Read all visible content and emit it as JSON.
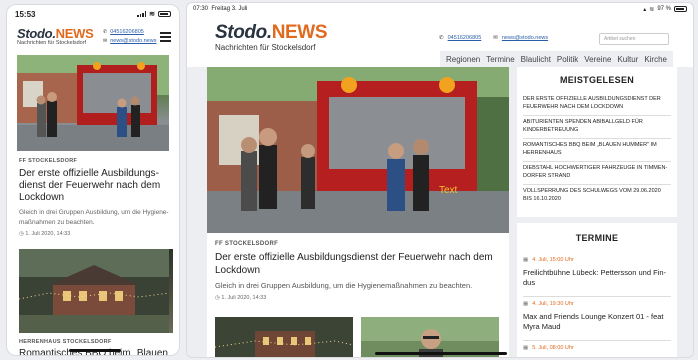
{
  "phone": {
    "status": {
      "time": "15:53"
    },
    "header": {
      "logo_main": "Stodo.",
      "logo_news": "NEWS",
      "logo_sub": "Nachrichten für Stockelsdorf",
      "phone": "04516206805",
      "email": "news@stodo.news"
    },
    "article1": {
      "category": "FF STOCKELSDORF",
      "title": "Der erste offizielle Ausbildungs­dienst der Feuerwehr nach dem Lockdown",
      "teaser": "Gleich in drei Gruppen Ausbildung, um die Hygiene­maßnahmen zu beachten.",
      "date": "1. Juli 2020, 14:33"
    },
    "article2": {
      "category": "HERRENHAUS STOCKELSDORF",
      "title": "Romantisches BBQ beim „Blauen Hummer\" im Herrenhaus"
    }
  },
  "tablet": {
    "status": {
      "time": "07:30",
      "date": "Freitag 3. Juli",
      "battery": "97 %"
    },
    "header": {
      "logo_main": "Stodo.",
      "logo_news": "NEWS",
      "logo_sub": "Nachrichten für Stockelsdorf",
      "phone": "04516206805",
      "email": "news@stodo.news",
      "search_placeholder": "Artikel suchen"
    },
    "nav": [
      "Regionen",
      "Termine",
      "Blaulicht",
      "Politik",
      "Vereine",
      "Kultur",
      "Kirche"
    ],
    "article": {
      "category": "FF STOCKELSDORF",
      "title": "Der erste offizielle Ausbildungsdienst der Feuerwehr nach dem Lock­down",
      "teaser": "Gleich in drei Gruppen Ausbildung, um die Hygienemaßnahmen zu beachten.",
      "date": "1. Juli 2020, 14:33",
      "image_overlay": "Text"
    },
    "meistgelesen": {
      "heading": "MEISTGELESEN",
      "items": [
        "DER ERSTE OFFIZIELLE AUSBILDUNGSDIENST DER FEU­ERWEHR NACH DEM LOCKDOWN",
        "ABITURIENTEN SPENDEN ABIBALLGELD FÜR KINDERBE­TREUUNG",
        "ROMANTISCHES BBQ BEIM „BLAUEN HUMMER\" IM HERRENHAUS",
        "DIEBSTAHL HOCHWERTIGER FAHRZEUGE IN TIMMEN­DORFER STRAND",
        "VOLLSPERRUNG DES SCHULWEGS VOM 29.06.2020 BIS 16.10.2020"
      ]
    },
    "termine": {
      "heading": "TERMINE",
      "items": [
        {
          "date": "4. Juli, 15:00 Uhr",
          "title": "Freilichtbühne Lübeck: Pettersson und Fin­dus"
        },
        {
          "date": "4. Juli, 19:30 Uhr",
          "title": "Max and Friends Lounge Konzert 01 - feat Myra Maud"
        },
        {
          "date": "5. Juli, 08:00 Uhr",
          "title": ""
        }
      ]
    }
  }
}
